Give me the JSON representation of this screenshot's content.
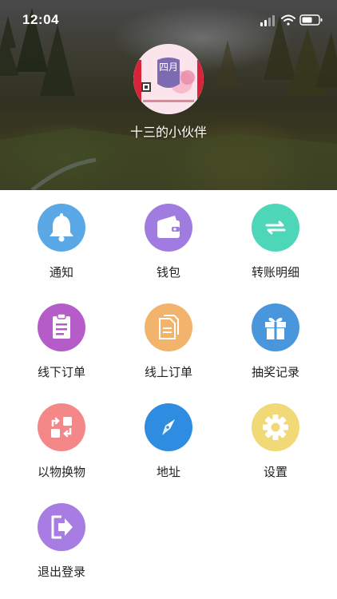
{
  "status": {
    "time": "12:04"
  },
  "profile": {
    "name": "十三的小伙伴",
    "avatar_text": "四月"
  },
  "menu": [
    {
      "label": "通知",
      "icon": "bell-icon",
      "color": "#5aa9e6"
    },
    {
      "label": "钱包",
      "icon": "wallet-icon",
      "color": "#a07ce0"
    },
    {
      "label": "转账明细",
      "icon": "transfer-icon",
      "color": "#4ed6b8"
    },
    {
      "label": "线下订单",
      "icon": "clipboard-icon",
      "color": "#b65cc9"
    },
    {
      "label": "线上订单",
      "icon": "documents-icon",
      "color": "#f2b46c"
    },
    {
      "label": "抽奖记录",
      "icon": "gift-icon",
      "color": "#4a96dc"
    },
    {
      "label": "以物换物",
      "icon": "exchange-icon",
      "color": "#f48787"
    },
    {
      "label": "地址",
      "icon": "compass-icon",
      "color": "#2e8de0"
    },
    {
      "label": "设置",
      "icon": "gear-icon",
      "color": "#f1d978"
    },
    {
      "label": "退出登录",
      "icon": "logout-icon",
      "color": "#a77de3"
    }
  ]
}
